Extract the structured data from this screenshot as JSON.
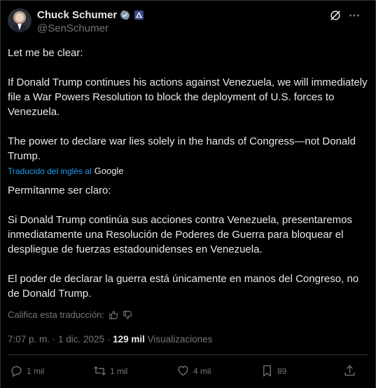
{
  "author": {
    "name": "Chuck Schumer",
    "handle": "@SenSchumer"
  },
  "tweet": {
    "original_text": "Let me be clear:\n\nIf Donald Trump continues his actions against Venezuela, we will immediately file a War Powers Resolution to block the deployment of U.S. forces to Venezuela.\n\nThe power to declare war lies solely in the hands of Congress—not Donald Trump.",
    "translated_label": "Traducido del inglés al",
    "translator_name": "Google",
    "translated_text": "Permítanme ser claro:\n\nSi Donald Trump continúa sus acciones contra Venezuela, presentaremos inmediatamente una Resolución de Poderes de Guerra para bloquear el despliegue de fuerzas estadounidenses en Venezuela.\n\nEl poder de declarar la guerra está únicamente en manos del Congreso, no de Donald Trump.",
    "rate_translation": "Califica esta traducción:",
    "timestamp": "7:07 p. m. · 1 dic. 2025 · ",
    "views_count": "129 mil",
    "views_label": " Visualizaciones"
  },
  "actions": {
    "replies": "1 mil",
    "reposts": "1 mil",
    "likes": "4 mil",
    "bookmarks": "89"
  },
  "colors": {
    "background": "#000000",
    "text": "#e7e9ea",
    "muted": "#71767b",
    "accent": "#1d9bf0",
    "border": "#2f3336"
  },
  "icons": {
    "verified": "verified-badge-icon",
    "government": "government-affiliation-icon",
    "grok": "grok-icon",
    "more": "more-options-icon",
    "reply": "reply-icon",
    "repost": "repost-icon",
    "like": "heart-icon",
    "bookmark": "bookmark-icon",
    "share": "share-icon"
  }
}
